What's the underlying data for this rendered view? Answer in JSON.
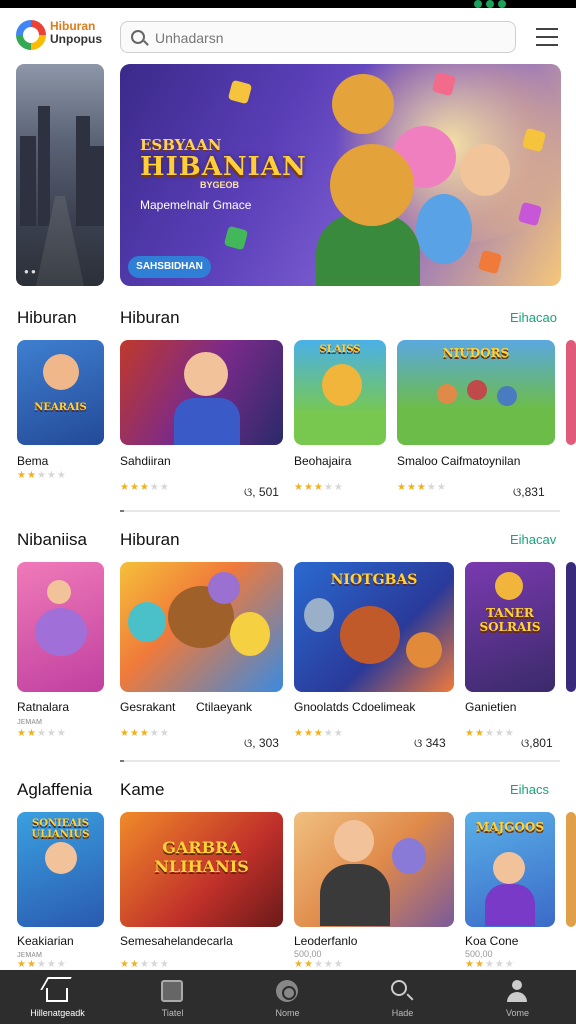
{
  "header": {
    "logo_line1": "Hiburan",
    "logo_line2": "Unpopus",
    "search_placeholder": "Unhadarsn"
  },
  "hero": {
    "title_small": "ESBYAAN",
    "title_big": "HIBANIAN",
    "title_tag": "BYGEOB",
    "subtitle": "Mapemelnalr Gmace",
    "button_label": "SAHSBIDHAN"
  },
  "sections": [
    {
      "title_a": "Hiburan",
      "title_b": "Hiburan",
      "more": "Eihacao",
      "cards": [
        {
          "title": "Bema",
          "thumb_text": "NEARAIS",
          "rating": 2,
          "price": ""
        },
        {
          "title": "Sahdiiran",
          "thumb_text": "",
          "rating": 3,
          "price": "ଓ, 501"
        },
        {
          "title": "Beohajaira",
          "thumb_text": "SLAISS",
          "rating": 3,
          "price": ""
        },
        {
          "title": "Smaloo Caifmatoynilan",
          "thumb_text": "NIUDORS",
          "rating": 3,
          "price": "ଓ,831"
        }
      ]
    },
    {
      "title_a": "Nibaniisa",
      "title_b": "Hiburan",
      "more": "Eihacav",
      "cards": [
        {
          "title": "Ratnalara",
          "sub": "ᴊᴇᴍᴀᴍ",
          "thumb_text": "",
          "rating": 2,
          "price": ""
        },
        {
          "title": "Gesrakant",
          "thumb_text": "",
          "rating": 3,
          "price": ""
        },
        {
          "title": "Ctilaeyank",
          "thumb_text": "",
          "rating": 0,
          "price": "ଓ, 303"
        },
        {
          "title": "Gnoolatds Cdoelimeak",
          "thumb_text": "NIOTGBAS",
          "rating": 3,
          "price": "ଓ 343"
        },
        {
          "title": "Ganietien",
          "thumb_text": "TANER SOLRAIS",
          "rating": 2,
          "price": "ଓ,801"
        }
      ]
    },
    {
      "title_a": "Aglaffenia",
      "title_b": "Kame",
      "more": "Eihacs",
      "cards": [
        {
          "title": "Keakiarian",
          "sub": "ᴊᴇᴍᴀᴍ",
          "thumb_text": "SONIEAIS ULIANIUS",
          "rating": 2,
          "price": ""
        },
        {
          "title": "Semesahelandecarla",
          "thumb_text": "GARBRA NLIHANIS",
          "rating": 2,
          "price": ""
        },
        {
          "title": "Leoderfanlo",
          "sub": "500,00",
          "thumb_text": "",
          "rating": 2,
          "price": ""
        },
        {
          "title": "Koa Cone",
          "sub": "500,00",
          "thumb_text": "MAJGOOS",
          "rating": 2,
          "price": ""
        }
      ]
    }
  ],
  "bottom_nav": [
    {
      "label": "Hillenatgeadk",
      "icon": "home-icon"
    },
    {
      "label": "Tiatel",
      "icon": "tablet-icon"
    },
    {
      "label": "Nome",
      "icon": "games-icon"
    },
    {
      "label": "Hade",
      "icon": "search-icon"
    },
    {
      "label": "Vome",
      "icon": "user-icon"
    }
  ],
  "colors": {
    "accent_green": "#1aa37a",
    "star": "#f2b01e",
    "nav_bg": "#2d2d2d"
  }
}
